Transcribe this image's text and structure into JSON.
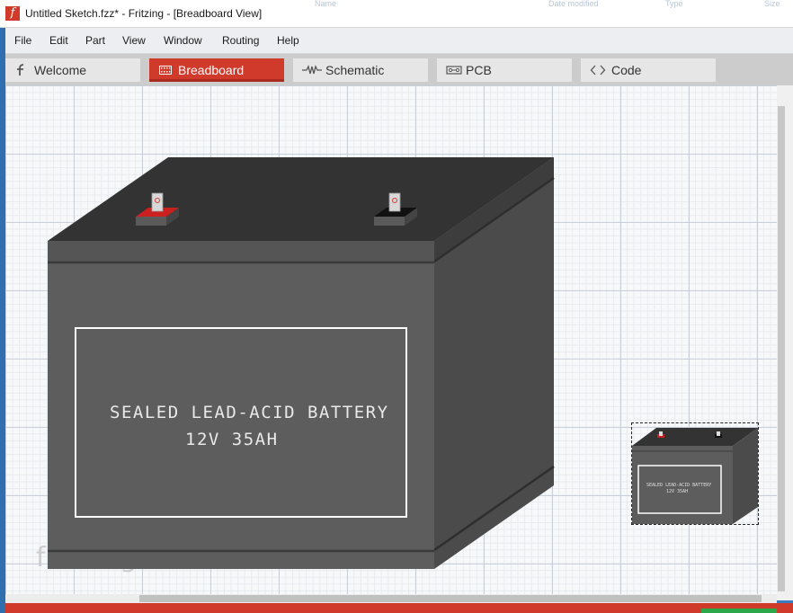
{
  "window": {
    "title": "Untitled Sketch.fzz* - Fritzing - [Breadboard View]",
    "app_icon_glyph": "f",
    "background_header_fragments": [
      "Name",
      "Date modified",
      "Type",
      "Size"
    ]
  },
  "menubar": {
    "items": [
      "File",
      "Edit",
      "Part",
      "View",
      "Window",
      "Routing",
      "Help"
    ]
  },
  "tabs": [
    {
      "label": "Welcome",
      "icon": "fritzing-f-icon",
      "active": false
    },
    {
      "label": "Breadboard",
      "icon": "breadboard-icon",
      "active": true
    },
    {
      "label": "Schematic",
      "icon": "resistor-icon",
      "active": false
    },
    {
      "label": "PCB",
      "icon": "pcb-icon",
      "active": false
    },
    {
      "label": "Code",
      "icon": "code-brackets-icon",
      "active": false
    }
  ],
  "canvas": {
    "watermark": "fritzing",
    "part": {
      "label_line_1": "SEALED LEAD-ACID BATTERY",
      "label_line_2": "12V 35AH"
    },
    "thumbnail": {
      "label_line_1": "SEALED LEAD-ACID BATTERY",
      "label_line_2": "12V 35AH"
    }
  },
  "colors": {
    "accent": "#d03a2b",
    "battery_top": "#333333",
    "battery_front": "#5e5e5e",
    "battery_side": "#4a4a4a",
    "terminal_positive": "#cc1f1f",
    "terminal_negative": "#111111",
    "status_green": "#2aa84a"
  }
}
